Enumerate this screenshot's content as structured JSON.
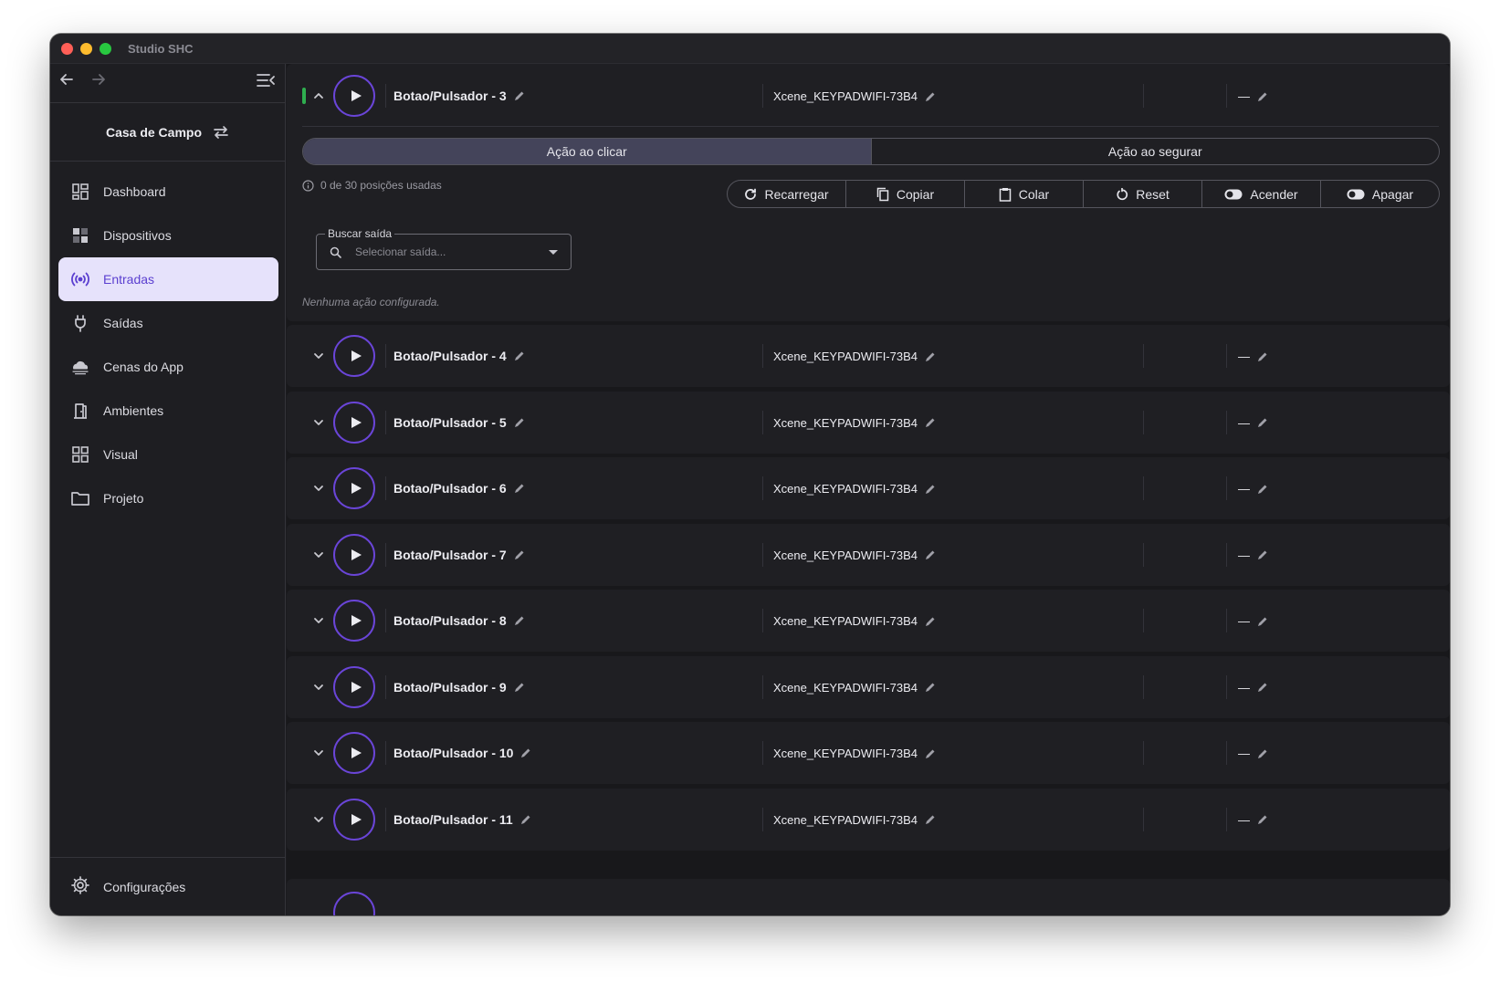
{
  "window": {
    "title": "Studio SHC"
  },
  "sidebar": {
    "project_name": "Casa de Campo",
    "items": [
      {
        "label": "Dashboard",
        "icon": "dashboard-icon",
        "active": false
      },
      {
        "label": "Dispositivos",
        "icon": "devices-icon",
        "active": false
      },
      {
        "label": "Entradas",
        "icon": "broadcast-icon",
        "active": true
      },
      {
        "label": "Saídas",
        "icon": "plug-icon",
        "active": false
      },
      {
        "label": "Cenas do App",
        "icon": "cloud-icon",
        "active": false
      },
      {
        "label": "Ambientes",
        "icon": "door-icon",
        "active": false
      },
      {
        "label": "Visual",
        "icon": "grid-icon",
        "active": false
      },
      {
        "label": "Projeto",
        "icon": "folder-icon",
        "active": false
      }
    ],
    "settings_label": "Configurações"
  },
  "expanded": {
    "name": "Botao/Pulsador - 3",
    "device": "Xcene_KEYPADWIFI-73B4",
    "value": "—",
    "tabs": [
      "Ação ao clicar",
      "Ação ao segurar"
    ],
    "usage": "0 de 30 posições usadas",
    "actions": [
      "Recarregar",
      "Copiar",
      "Colar",
      "Reset",
      "Acender",
      "Apagar"
    ],
    "search_label": "Buscar saída",
    "search_placeholder": "Selecionar saída...",
    "empty_message": "Nenhuma ação configurada."
  },
  "inputs": [
    {
      "name": "Botao/Pulsador - 4",
      "device": "Xcene_KEYPADWIFI-73B4",
      "value": "—"
    },
    {
      "name": "Botao/Pulsador - 5",
      "device": "Xcene_KEYPADWIFI-73B4",
      "value": "—"
    },
    {
      "name": "Botao/Pulsador - 6",
      "device": "Xcene_KEYPADWIFI-73B4",
      "value": "—"
    },
    {
      "name": "Botao/Pulsador - 7",
      "device": "Xcene_KEYPADWIFI-73B4",
      "value": "—"
    },
    {
      "name": "Botao/Pulsador - 8",
      "device": "Xcene_KEYPADWIFI-73B4",
      "value": "—"
    },
    {
      "name": "Botao/Pulsador - 9",
      "device": "Xcene_KEYPADWIFI-73B4",
      "value": "—"
    },
    {
      "name": "Botao/Pulsador - 10",
      "device": "Xcene_KEYPADWIFI-73B4",
      "value": "—"
    },
    {
      "name": "Botao/Pulsador - 11",
      "device": "Xcene_KEYPADWIFI-73B4",
      "value": "—"
    }
  ],
  "colors": {
    "accent": "#6a45d8",
    "active_bg": "#e6e2fb",
    "selected_indicator": "#2fae4f"
  }
}
